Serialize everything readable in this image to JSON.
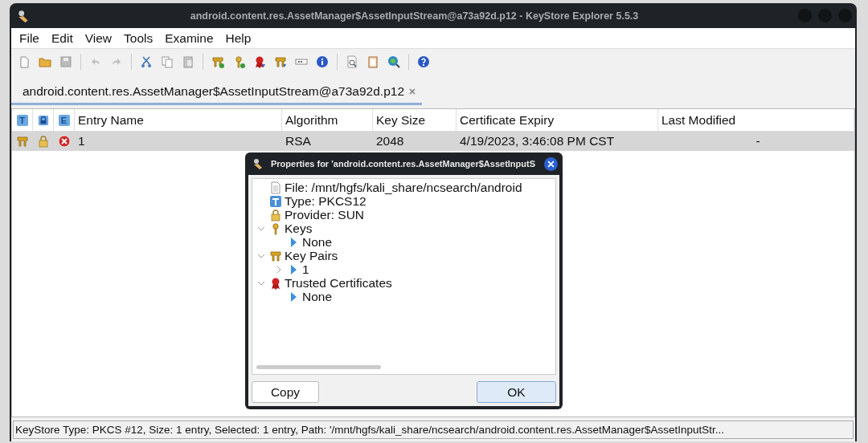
{
  "window": {
    "title": "android.content.res.AssetManager$AssetInputStream@a73a92d.p12 - KeyStore Explorer 5.5.3"
  },
  "menu": [
    "File",
    "Edit",
    "View",
    "Tools",
    "Examine",
    "Help"
  ],
  "tabs": [
    {
      "label": "android.content.res.AssetManager$AssetInputStream@a73a92d.p12",
      "selected": true
    }
  ],
  "table": {
    "columns": [
      {
        "label": "T",
        "kind": "letter"
      },
      {
        "kind": "lock"
      },
      {
        "label": "E",
        "kind": "letter"
      },
      {
        "label": "Entry Name",
        "kind": "text"
      },
      {
        "label": "Algorithm",
        "kind": "text"
      },
      {
        "label": "Key Size",
        "kind": "text"
      },
      {
        "label": "Certificate Expiry",
        "kind": "text"
      },
      {
        "label": "Last Modified",
        "kind": "text"
      }
    ],
    "rows": [
      {
        "selected": true,
        "cells": [
          "",
          "",
          "",
          "1",
          "RSA",
          "2048",
          "4/19/2023, 3:46:08 PM CST",
          "-"
        ]
      }
    ]
  },
  "dialog": {
    "title": "Properties for 'android.content.res.AssetManager$AssetInputS",
    "tree": [
      {
        "label": "File: /mnt/hgfs/kali_share/ncsearch/android",
        "kind": "file"
      },
      {
        "label": "Type: PKCS12",
        "kind": "type"
      },
      {
        "label": "Provider: SUN",
        "kind": "provider"
      },
      {
        "label": "Keys",
        "kind": "keys",
        "expanded": true,
        "children": [
          {
            "label": "None",
            "kind": "entry"
          }
        ]
      },
      {
        "label": "Key Pairs",
        "kind": "keypairs",
        "expanded": true,
        "children": [
          {
            "label": "1",
            "kind": "entry",
            "expanded": false
          }
        ]
      },
      {
        "label": "Trusted Certificates",
        "kind": "certs",
        "expanded": true,
        "children": [
          {
            "label": "None",
            "kind": "entry"
          }
        ]
      }
    ],
    "buttons": [
      {
        "label": "Copy",
        "selected": false
      },
      {
        "label": "OK",
        "selected": true
      }
    ]
  },
  "status_bar": "KeyStore Type: PKCS #12, Size: 1 entry, Selected: 1 entry, Path: '/mnt/hgfs/kali_share/ncsearch/android.content.res.AssetManager$AssetInputStr..."
}
